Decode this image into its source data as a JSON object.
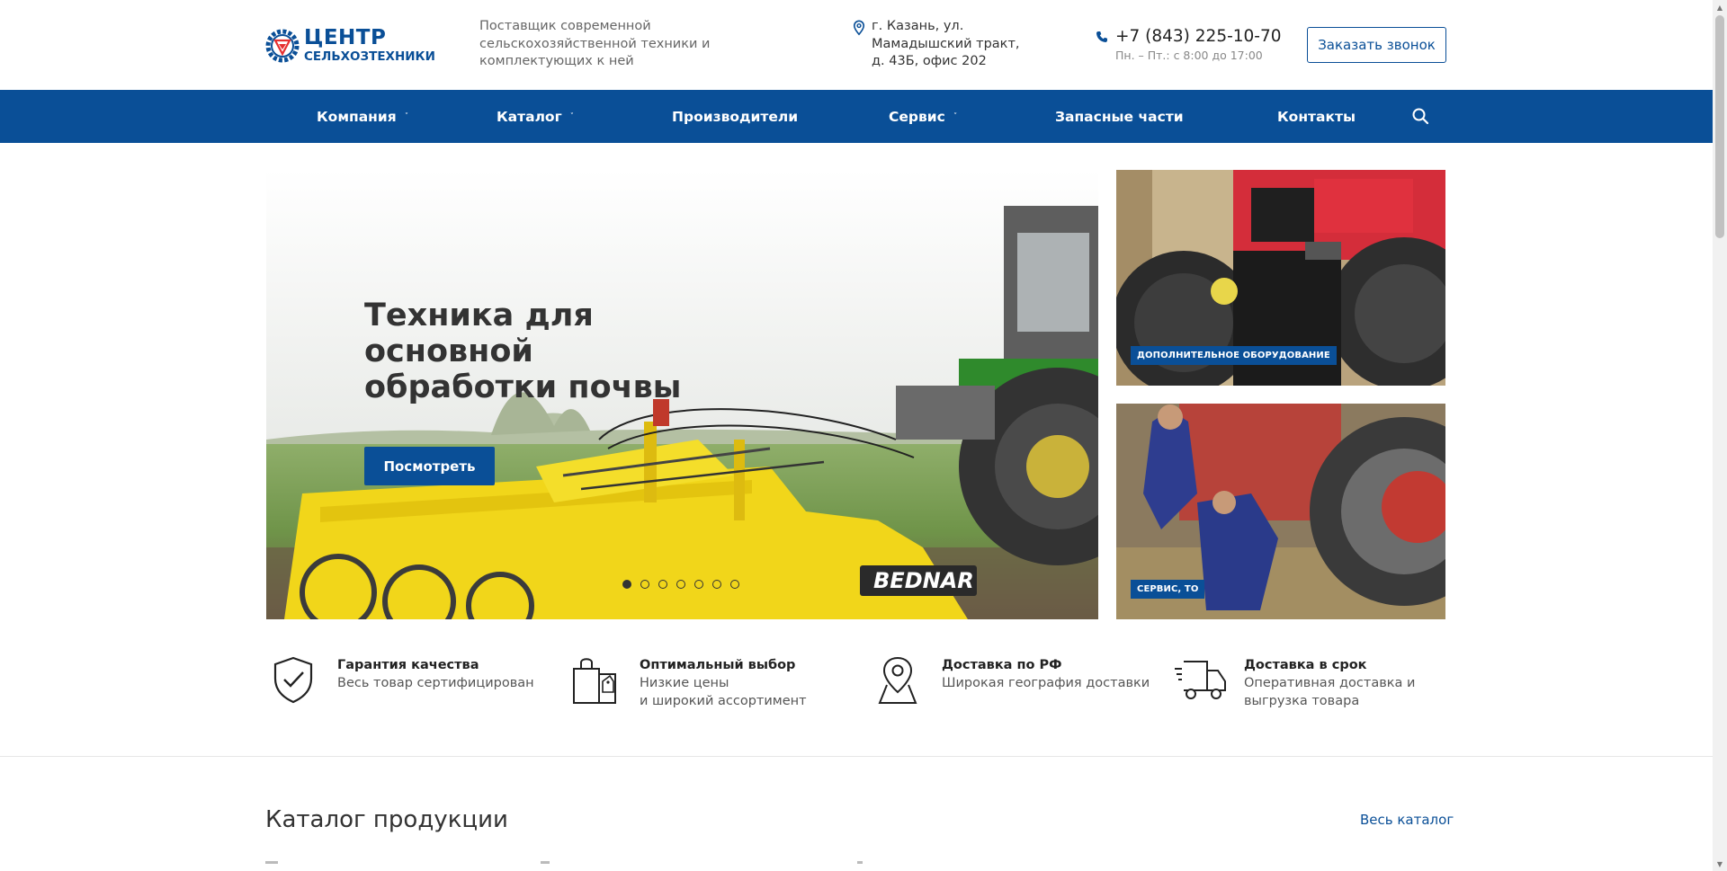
{
  "header": {
    "logo_line1": "ЦЕНТР",
    "logo_line2": "СЕЛЬХОЗТЕХНИКИ",
    "tagline": "Поставщик современной сельскохозяйственной техники и комплектующих к ней",
    "address": "г. Казань, ул. Мамадышский тракт, д. 43Б, офис 202",
    "phone": "+7 (843) 225-10-70",
    "hours": "Пн. – Пт.: с 8:00 до 17:00",
    "callback_label": "Заказать звонок"
  },
  "nav": {
    "items": [
      {
        "label": "Компания",
        "dropdown": true
      },
      {
        "label": "Каталог",
        "dropdown": true
      },
      {
        "label": "Производители",
        "dropdown": false
      },
      {
        "label": "Сервис",
        "dropdown": true
      },
      {
        "label": "Запасные части",
        "dropdown": false
      },
      {
        "label": "Контакты",
        "dropdown": false
      }
    ],
    "chevron": "˅",
    "search_icon": "search-icon"
  },
  "hero": {
    "title": "Техника для основной обработки почвы",
    "button_label": "Посмотреть",
    "brand_text": "BEDNAR",
    "slides_count": 7,
    "active_slide": 1
  },
  "banners": [
    {
      "label": "ДОПОЛНИТЕЛЬНОЕ ОБОРУДОВАНИЕ"
    },
    {
      "label": "СЕРВИС, ТО"
    }
  ],
  "advantages": [
    {
      "icon": "shield-check-icon",
      "title": "Гарантия качества",
      "desc": "Весь товар сертифицирован"
    },
    {
      "icon": "shopping-bag-icon",
      "title": "Оптимальный выбор",
      "desc": "Низкие цены\nи широкий ассортимент"
    },
    {
      "icon": "map-pin-icon",
      "title": "Доставка по РФ",
      "desc": "Широкая география доставки"
    },
    {
      "icon": "delivery-truck-icon",
      "title": "Доставка в срок",
      "desc": "Оперативная доставка и\nвыгрузка товара"
    }
  ],
  "catalog": {
    "title": "Каталог продукции",
    "all_link": "Весь каталог"
  },
  "colors": {
    "brand_blue": "#0a4f97",
    "accent_red": "#e63030",
    "text_dark": "#333333"
  }
}
